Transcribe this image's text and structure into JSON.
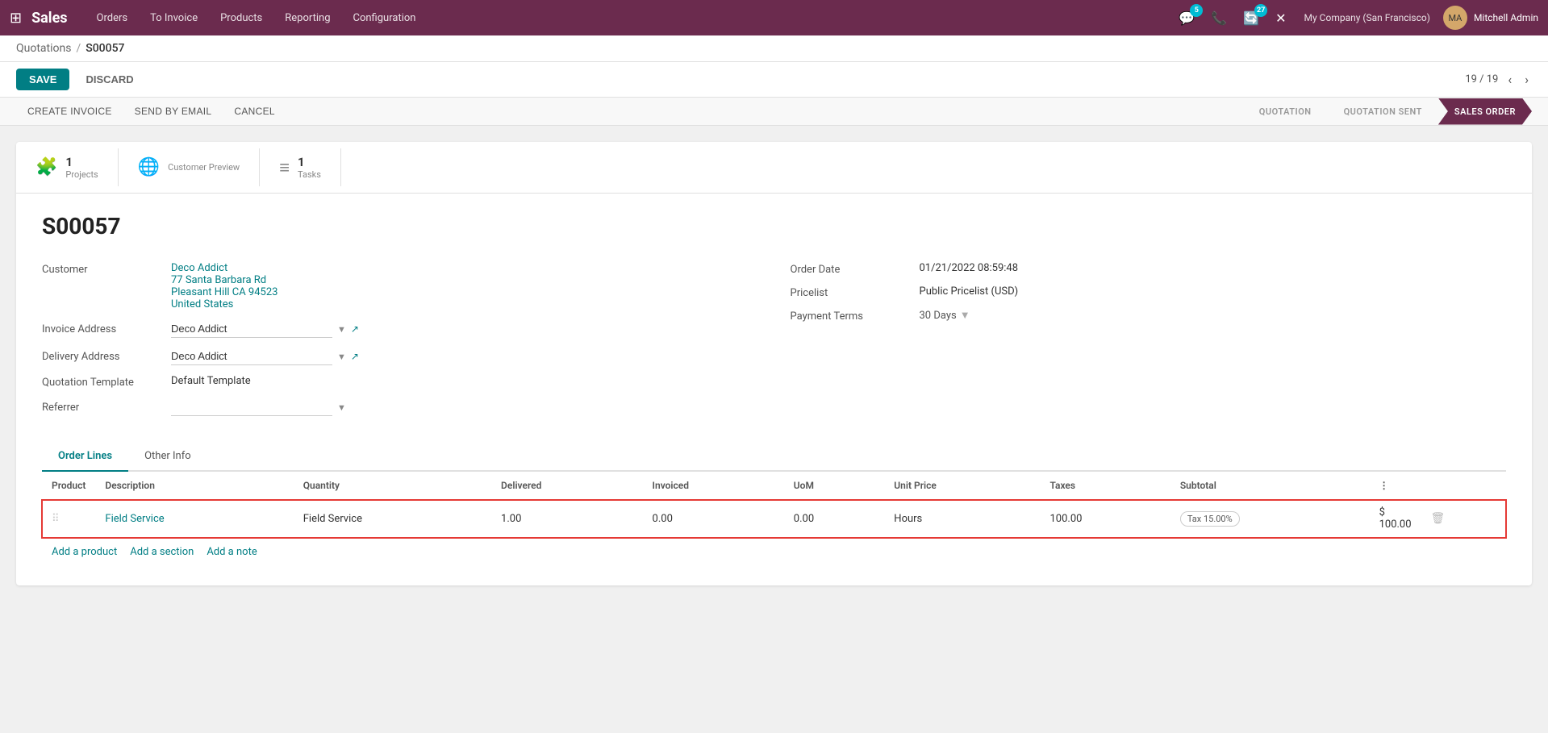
{
  "nav": {
    "brand": "Sales",
    "items": [
      "Orders",
      "To Invoice",
      "Products",
      "Reporting",
      "Configuration"
    ],
    "notifications_count": "5",
    "updates_count": "27",
    "company": "My Company (San Francisco)",
    "user": "Mitchell Admin"
  },
  "breadcrumb": {
    "parent": "Quotations",
    "current": "S00057"
  },
  "toolbar": {
    "save_label": "SAVE",
    "discard_label": "DISCARD",
    "pager": "19 / 19"
  },
  "status_bar": {
    "actions": [
      "CREATE INVOICE",
      "SEND BY EMAIL",
      "CANCEL"
    ],
    "stages": [
      "QUOTATION",
      "QUOTATION SENT",
      "SALES ORDER"
    ],
    "active_stage": "SALES ORDER"
  },
  "smart_buttons": [
    {
      "icon": "🧩",
      "count": "1",
      "label": "Projects"
    },
    {
      "icon": "🌐",
      "count": "",
      "label": "Customer Preview"
    },
    {
      "icon": "≡",
      "count": "1",
      "label": "Tasks"
    }
  ],
  "form": {
    "order_number": "S00057",
    "customer": {
      "label": "Customer",
      "name": "Deco Addict",
      "address1": "77 Santa Barbara Rd",
      "address2": "Pleasant Hill CA 94523",
      "country": "United States"
    },
    "invoice_address": {
      "label": "Invoice Address",
      "value": "Deco Addict"
    },
    "delivery_address": {
      "label": "Delivery Address",
      "value": "Deco Addict"
    },
    "quotation_template": {
      "label": "Quotation Template",
      "value": "Default Template"
    },
    "referrer": {
      "label": "Referrer",
      "value": ""
    },
    "order_date": {
      "label": "Order Date",
      "value": "01/21/2022 08:59:48"
    },
    "pricelist": {
      "label": "Pricelist",
      "value": "Public Pricelist (USD)"
    },
    "payment_terms": {
      "label": "Payment Terms",
      "value": "30 Days"
    }
  },
  "tabs": [
    "Order Lines",
    "Other Info"
  ],
  "active_tab": "Order Lines",
  "table": {
    "columns": [
      "Product",
      "Description",
      "Quantity",
      "Delivered",
      "Invoiced",
      "UoM",
      "Unit Price",
      "Taxes",
      "Subtotal",
      ""
    ],
    "rows": [
      {
        "product": "Field Service",
        "description": "Field Service",
        "quantity": "1.00",
        "delivered": "0.00",
        "invoiced": "0.00",
        "uom": "Hours",
        "unit_price": "100.00",
        "taxes": "Tax 15.00%",
        "subtotal": "$ 100.00"
      }
    ]
  },
  "add_actions": [
    "Add a product",
    "Add a section",
    "Add a note"
  ]
}
